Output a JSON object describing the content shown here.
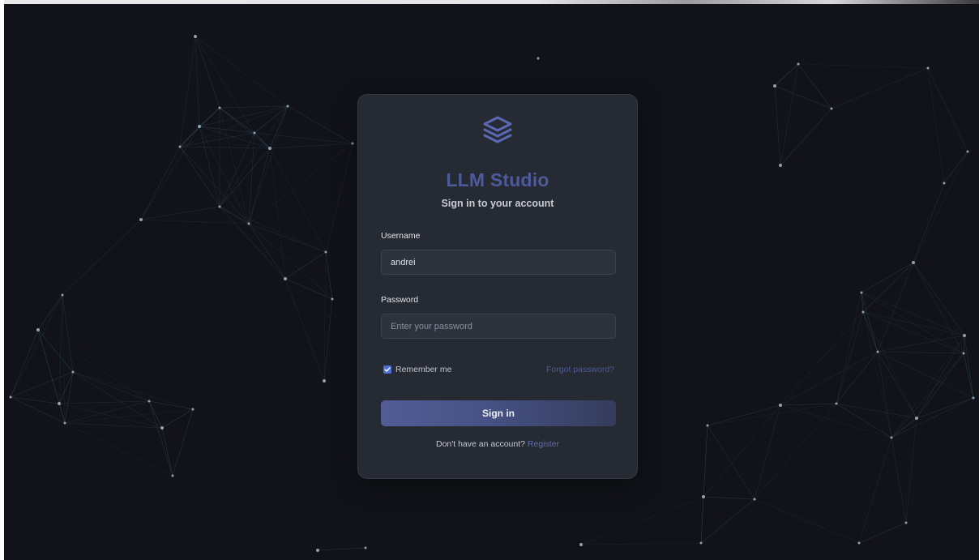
{
  "app": {
    "name": "LLM Studio",
    "subtitle": "Sign in to your account",
    "accent_color": "#4d5a9c",
    "logo_icon": "stacked-layers-icon"
  },
  "form": {
    "username_label": "Username",
    "username_value": "andrei",
    "password_label": "Password",
    "password_placeholder": "Enter your password",
    "remember_label": "Remember me",
    "remember_checked": true,
    "forgot_label": "Forgot password?",
    "submit_label": "Sign in",
    "register_prompt": "Don't have an account?",
    "register_label": "Register"
  }
}
